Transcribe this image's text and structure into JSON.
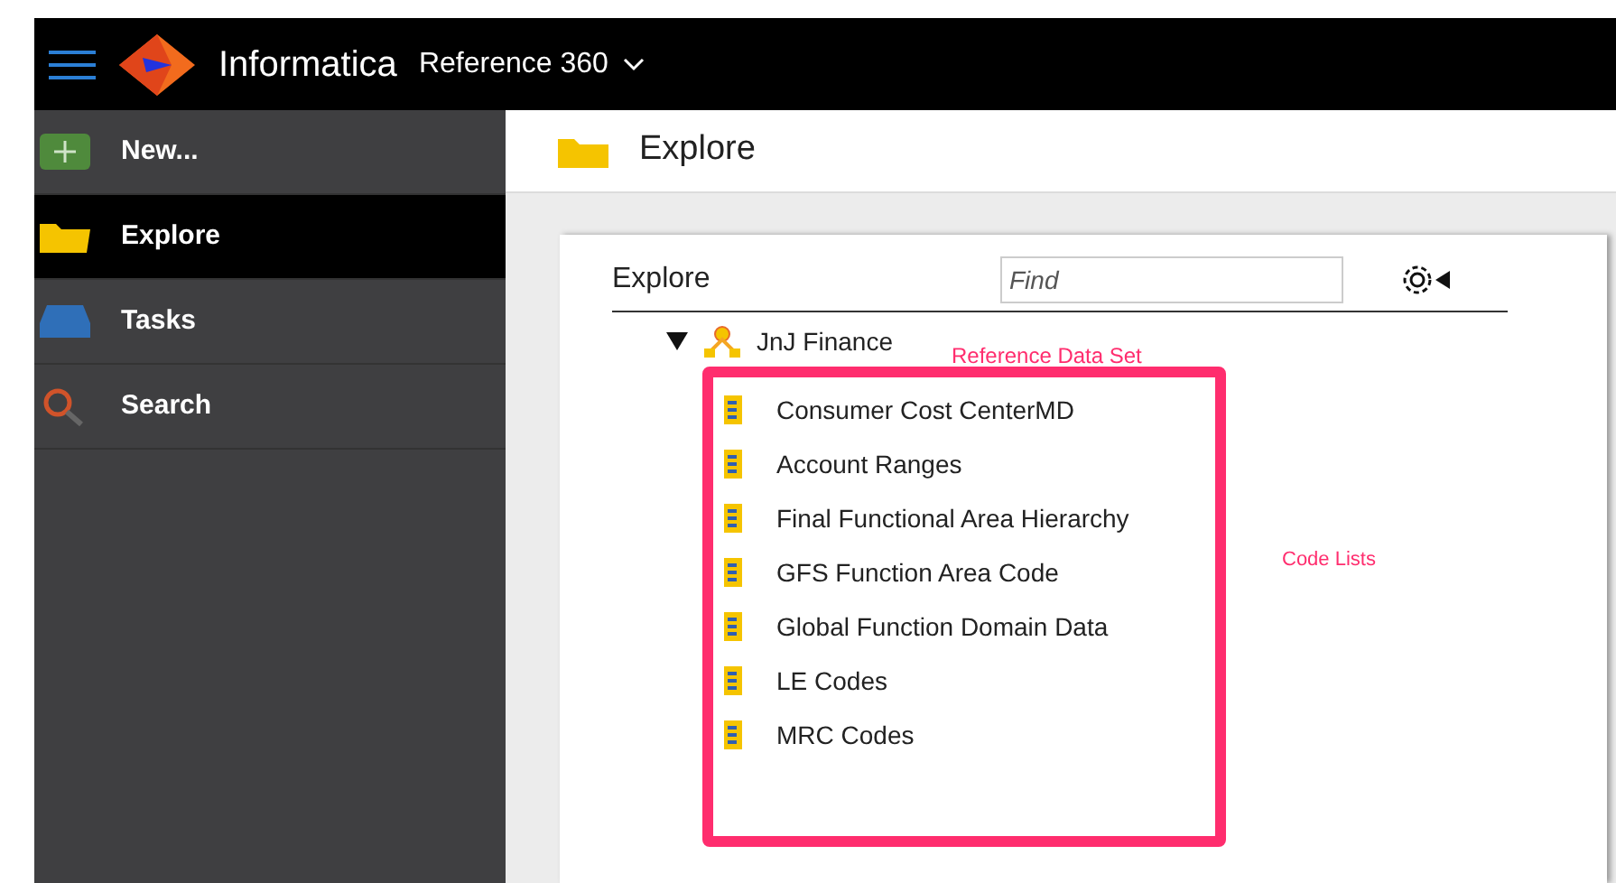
{
  "header": {
    "brand": "Informatica",
    "product": "Reference 360"
  },
  "sidebar": {
    "items": [
      {
        "kind": "new",
        "label": "New...",
        "selected": false
      },
      {
        "kind": "explore",
        "label": "Explore",
        "selected": true
      },
      {
        "kind": "tasks",
        "label": "Tasks",
        "selected": false
      },
      {
        "kind": "search",
        "label": "Search",
        "selected": false
      }
    ]
  },
  "page_title": "Explore",
  "panel": {
    "title": "Explore",
    "search": {
      "placeholder": "Find"
    },
    "tree": [
      {
        "label": "JnJ Finance",
        "expanded": true,
        "children": [
          {
            "label": "Consumer Cost CenterMD"
          },
          {
            "label": "Account Ranges"
          },
          {
            "label": "Final Functional Area Hierarchy"
          },
          {
            "label": "GFS Function Area Code"
          },
          {
            "label": "Global Function Domain Data"
          },
          {
            "label": "LE Codes"
          },
          {
            "label": "MRC Codes"
          }
        ]
      }
    ]
  },
  "annotations": {
    "root_note": "Reference Data Set",
    "children_note": "Code Lists"
  }
}
